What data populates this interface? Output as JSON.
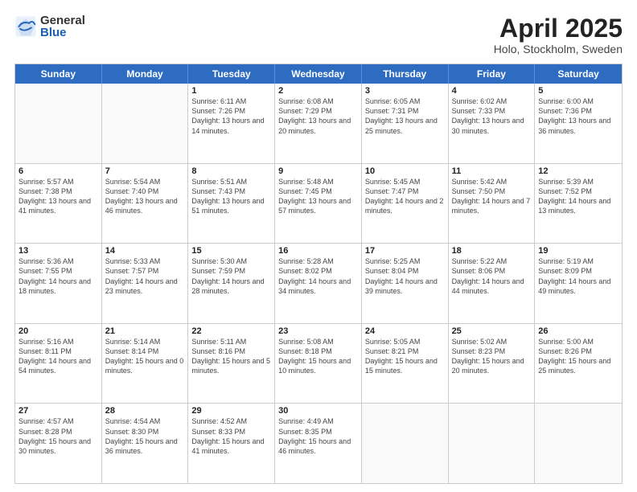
{
  "header": {
    "logo_general": "General",
    "logo_blue": "Blue",
    "title": "April 2025",
    "location": "Holo, Stockholm, Sweden"
  },
  "days_of_week": [
    "Sunday",
    "Monday",
    "Tuesday",
    "Wednesday",
    "Thursday",
    "Friday",
    "Saturday"
  ],
  "weeks": [
    [
      {
        "day": "",
        "info": ""
      },
      {
        "day": "",
        "info": ""
      },
      {
        "day": "1",
        "info": "Sunrise: 6:11 AM\nSunset: 7:26 PM\nDaylight: 13 hours and 14 minutes."
      },
      {
        "day": "2",
        "info": "Sunrise: 6:08 AM\nSunset: 7:29 PM\nDaylight: 13 hours and 20 minutes."
      },
      {
        "day": "3",
        "info": "Sunrise: 6:05 AM\nSunset: 7:31 PM\nDaylight: 13 hours and 25 minutes."
      },
      {
        "day": "4",
        "info": "Sunrise: 6:02 AM\nSunset: 7:33 PM\nDaylight: 13 hours and 30 minutes."
      },
      {
        "day": "5",
        "info": "Sunrise: 6:00 AM\nSunset: 7:36 PM\nDaylight: 13 hours and 36 minutes."
      }
    ],
    [
      {
        "day": "6",
        "info": "Sunrise: 5:57 AM\nSunset: 7:38 PM\nDaylight: 13 hours and 41 minutes."
      },
      {
        "day": "7",
        "info": "Sunrise: 5:54 AM\nSunset: 7:40 PM\nDaylight: 13 hours and 46 minutes."
      },
      {
        "day": "8",
        "info": "Sunrise: 5:51 AM\nSunset: 7:43 PM\nDaylight: 13 hours and 51 minutes."
      },
      {
        "day": "9",
        "info": "Sunrise: 5:48 AM\nSunset: 7:45 PM\nDaylight: 13 hours and 57 minutes."
      },
      {
        "day": "10",
        "info": "Sunrise: 5:45 AM\nSunset: 7:47 PM\nDaylight: 14 hours and 2 minutes."
      },
      {
        "day": "11",
        "info": "Sunrise: 5:42 AM\nSunset: 7:50 PM\nDaylight: 14 hours and 7 minutes."
      },
      {
        "day": "12",
        "info": "Sunrise: 5:39 AM\nSunset: 7:52 PM\nDaylight: 14 hours and 13 minutes."
      }
    ],
    [
      {
        "day": "13",
        "info": "Sunrise: 5:36 AM\nSunset: 7:55 PM\nDaylight: 14 hours and 18 minutes."
      },
      {
        "day": "14",
        "info": "Sunrise: 5:33 AM\nSunset: 7:57 PM\nDaylight: 14 hours and 23 minutes."
      },
      {
        "day": "15",
        "info": "Sunrise: 5:30 AM\nSunset: 7:59 PM\nDaylight: 14 hours and 28 minutes."
      },
      {
        "day": "16",
        "info": "Sunrise: 5:28 AM\nSunset: 8:02 PM\nDaylight: 14 hours and 34 minutes."
      },
      {
        "day": "17",
        "info": "Sunrise: 5:25 AM\nSunset: 8:04 PM\nDaylight: 14 hours and 39 minutes."
      },
      {
        "day": "18",
        "info": "Sunrise: 5:22 AM\nSunset: 8:06 PM\nDaylight: 14 hours and 44 minutes."
      },
      {
        "day": "19",
        "info": "Sunrise: 5:19 AM\nSunset: 8:09 PM\nDaylight: 14 hours and 49 minutes."
      }
    ],
    [
      {
        "day": "20",
        "info": "Sunrise: 5:16 AM\nSunset: 8:11 PM\nDaylight: 14 hours and 54 minutes."
      },
      {
        "day": "21",
        "info": "Sunrise: 5:14 AM\nSunset: 8:14 PM\nDaylight: 15 hours and 0 minutes."
      },
      {
        "day": "22",
        "info": "Sunrise: 5:11 AM\nSunset: 8:16 PM\nDaylight: 15 hours and 5 minutes."
      },
      {
        "day": "23",
        "info": "Sunrise: 5:08 AM\nSunset: 8:18 PM\nDaylight: 15 hours and 10 minutes."
      },
      {
        "day": "24",
        "info": "Sunrise: 5:05 AM\nSunset: 8:21 PM\nDaylight: 15 hours and 15 minutes."
      },
      {
        "day": "25",
        "info": "Sunrise: 5:02 AM\nSunset: 8:23 PM\nDaylight: 15 hours and 20 minutes."
      },
      {
        "day": "26",
        "info": "Sunrise: 5:00 AM\nSunset: 8:26 PM\nDaylight: 15 hours and 25 minutes."
      }
    ],
    [
      {
        "day": "27",
        "info": "Sunrise: 4:57 AM\nSunset: 8:28 PM\nDaylight: 15 hours and 30 minutes."
      },
      {
        "day": "28",
        "info": "Sunrise: 4:54 AM\nSunset: 8:30 PM\nDaylight: 15 hours and 36 minutes."
      },
      {
        "day": "29",
        "info": "Sunrise: 4:52 AM\nSunset: 8:33 PM\nDaylight: 15 hours and 41 minutes."
      },
      {
        "day": "30",
        "info": "Sunrise: 4:49 AM\nSunset: 8:35 PM\nDaylight: 15 hours and 46 minutes."
      },
      {
        "day": "",
        "info": ""
      },
      {
        "day": "",
        "info": ""
      },
      {
        "day": "",
        "info": ""
      }
    ]
  ]
}
